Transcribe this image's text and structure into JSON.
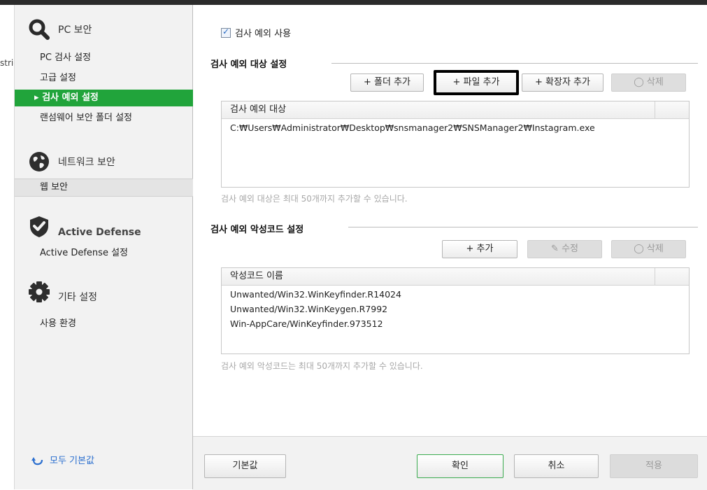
{
  "edge_fragment": "stric",
  "sidebar": {
    "sections": [
      {
        "title": "PC 보안",
        "icon": "search-icon",
        "items": [
          {
            "label": "PC 검사 설정"
          },
          {
            "label": "고급 설정"
          },
          {
            "label": "검사 예외 설정",
            "active": true
          },
          {
            "label": "랜섬웨어 보안 폴더 설정"
          }
        ]
      },
      {
        "title": "네트워크 보안",
        "icon": "globe-icon",
        "items": [
          {
            "label": "웹 보안"
          }
        ]
      },
      {
        "title": "Active Defense",
        "icon": "shield-check-icon",
        "items": [
          {
            "label": "Active Defense 설정"
          }
        ]
      },
      {
        "title": "기타 설정",
        "icon": "gear-icon",
        "items": [
          {
            "label": "사용 환경"
          }
        ]
      }
    ],
    "active_marker": "▸",
    "reset_all_label": "모두 기본값",
    "reset_all_icon": "undo-arrow-icon"
  },
  "main": {
    "enable_exception": {
      "label": "검사 예외 사용",
      "checked": true
    },
    "target_section": {
      "title": "검사 예외 대상 설정",
      "buttons": {
        "add_folder": "+ 폴더 추가",
        "add_file": "+ 파일 추가",
        "add_extension": "+ 확장자 추가",
        "delete": "삭제"
      },
      "delete_icon": "eraser-icon",
      "column_header": "검사 예외 대상",
      "rows": [
        "C:₩Users₩Administrator₩Desktop₩snsmanager2₩SNSManager2₩Instagram.exe"
      ],
      "hint": "검사 예외 대상은 최대 50개까지 추가할 수 있습니다."
    },
    "malware_section": {
      "title": "검사 예외 악성코드 설정",
      "buttons": {
        "add": "+ 추가",
        "edit": "수정",
        "delete": "삭제"
      },
      "edit_icon": "pencil-icon",
      "delete_icon": "eraser-icon",
      "column_header": "악성코드 이름",
      "rows": [
        "Unwanted/Win32.WinKeyfinder.R14024",
        "Unwanted/Win32.WinKeygen.R7992",
        "Win-AppCare/WinKeyfinder.973512"
      ],
      "hint": "검사 예외 악성코드는 최대 50개까지 추가할 수 있습니다."
    }
  },
  "footer": {
    "default": "기본값",
    "ok": "확인",
    "cancel": "취소",
    "apply": "적용"
  },
  "colors": {
    "active_nav": "#21a43b",
    "link": "#2b6fcf",
    "disabled_text": "#9a9a9a"
  }
}
